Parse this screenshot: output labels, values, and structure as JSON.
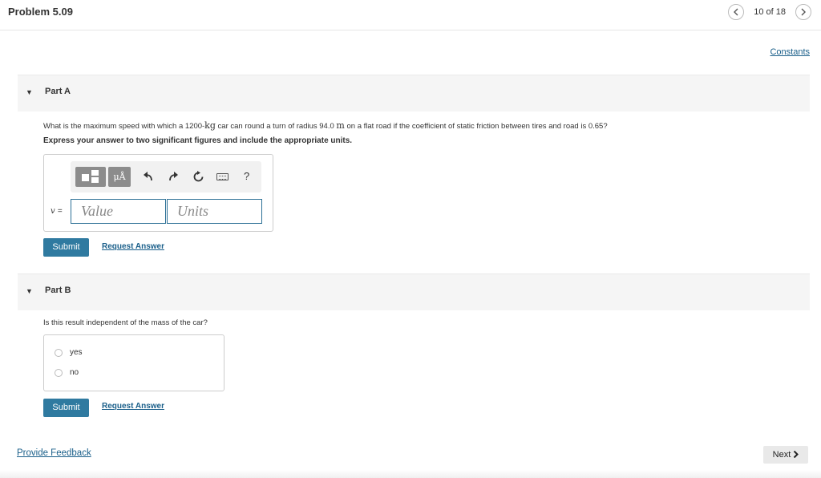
{
  "header": {
    "title": "Problem 5.09",
    "pager_text": "10 of 18",
    "prev_icon": "chevron-left-icon",
    "next_icon": "chevron-right-icon"
  },
  "constants_link": "Constants",
  "part_a": {
    "label": "Part A",
    "question_before_kg": "What is the maximum speed with which a 1200-",
    "kg_unit": "kg",
    "question_mid": " car can round a turn of radius 94.0 ",
    "m_unit": "m",
    "question_after": " on a flat road if the coefficient of static friction between tires and road is 0.65?",
    "instruction": "Express your answer to two significant figures and include the appropriate units.",
    "toolbar": {
      "units_label": "μÅ",
      "undo_icon": "undo-icon",
      "redo_icon": "redo-icon",
      "reset_icon": "reset-icon",
      "keyboard_icon": "keyboard-icon",
      "help_label": "?"
    },
    "variable": "v",
    "equals": "=",
    "value_placeholder": "Value",
    "units_placeholder": "Units",
    "submit_label": "Submit",
    "request_label": "Request Answer"
  },
  "part_b": {
    "label": "Part B",
    "question": "Is this result independent of the mass of the car?",
    "options": [
      "yes",
      "no"
    ],
    "submit_label": "Submit",
    "request_label": "Request Answer"
  },
  "footer": {
    "feedback_label": "Provide Feedback",
    "next_label": "Next"
  },
  "colors": {
    "accent": "#2f7aa0",
    "link": "#1a5f8a"
  }
}
